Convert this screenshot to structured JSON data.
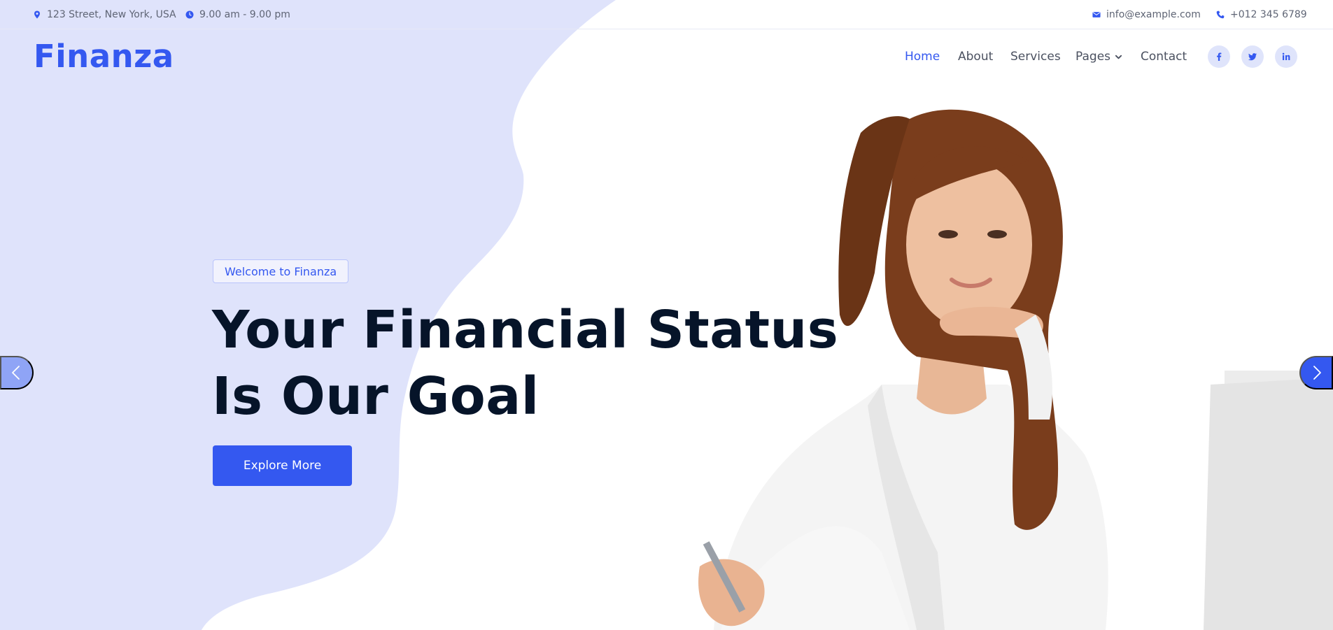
{
  "colors": {
    "accent": "#3458f0",
    "blob": "#dfe3fb",
    "heading": "#061429",
    "text": "#5f6575"
  },
  "topbar": {
    "address": "123 Street, New York, USA",
    "address_icon": "map-marker-icon",
    "hours": "9.00 am - 9.00 pm",
    "hours_icon": "clock-icon",
    "email": "info@example.com",
    "email_icon": "envelope-icon",
    "phone": "+012 345 6789",
    "phone_icon": "phone-icon"
  },
  "navbar": {
    "logo": "Finanza",
    "items": [
      {
        "label": "Home",
        "active": true
      },
      {
        "label": "About",
        "active": false
      },
      {
        "label": "Services",
        "active": false
      },
      {
        "label": "Pages",
        "active": false,
        "dropdown": true
      },
      {
        "label": "Contact",
        "active": false
      }
    ],
    "social": [
      "facebook-icon",
      "twitter-icon",
      "linkedin-icon"
    ]
  },
  "hero": {
    "badge": "Welcome to Finanza",
    "headline_line1": "Your Financial Status",
    "headline_line2": "Is Our Goal",
    "cta_label": "Explore More",
    "image": "woman-at-desk-photo"
  },
  "carousel": {
    "prev_icon": "chevron-left-icon",
    "next_icon": "chevron-right-icon"
  }
}
